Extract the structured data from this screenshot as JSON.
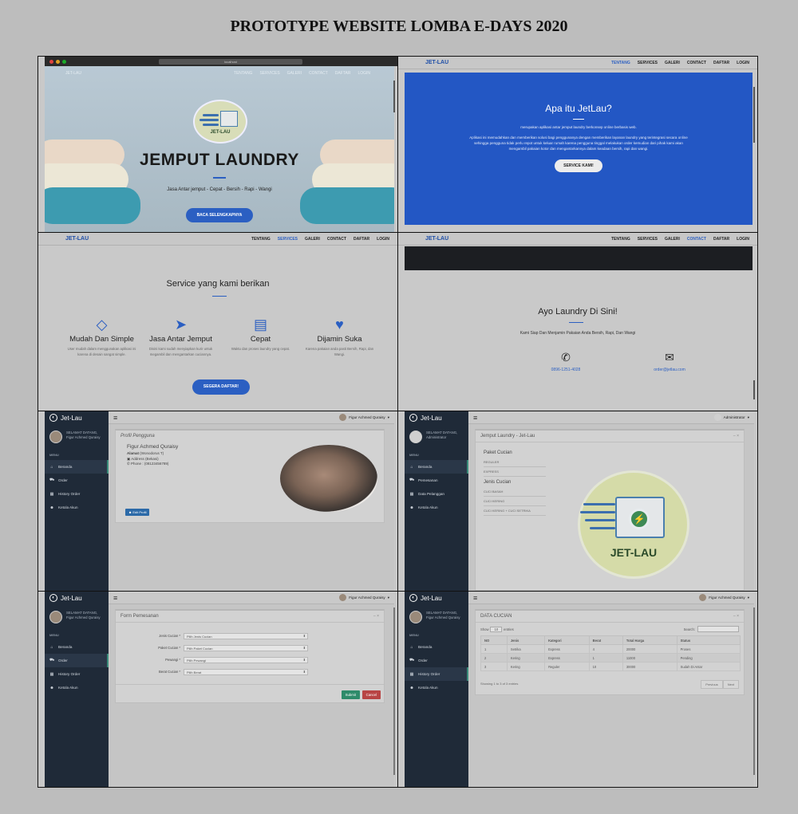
{
  "doc_title": "PROTOTYPE WEBSITE LOMBA E-DAYS 2020",
  "site": {
    "brand": "JET-LAU",
    "nav": [
      "TENTANG",
      "SERVICES",
      "GALERI",
      "CONTACT",
      "DAFTAR",
      "LOGIN"
    ]
  },
  "browser": {
    "address": "localhost"
  },
  "hero": {
    "logo_text": "JET-LAU",
    "title": "JEMPUT LAUNDRY",
    "subtitle": "Jasa Antar jemput - Cepat - Bersih - Rapi - Wangi",
    "button": "BACA SELENGKAPNYA"
  },
  "about": {
    "title": "Apa itu JetLau?",
    "lead": "merupakan aplikasi antar jemput laundry berkonsep online berbasis web.",
    "body": "Aplikasi ini memudahkan dan memberikan solusi bagi penggunanya dengan memberikan layanan laundry yang terintegrasi secara online sehingga pengguna tidak perlu repot untuk keluar rumah karena pengguna tinggal melakukan order kemudian dari pihak kami akan mengambil pakaian kotor dan mengantarkannya dalam keadaan bersih, rapi dan wangi.",
    "button": "SERVICE KAMI!"
  },
  "services": {
    "title": "Service yang kami berikan",
    "items": [
      {
        "icon": "diamond-icon",
        "title": "Mudah Dan Simple",
        "desc": "User mudah dalam menggunakan aplikasi ini karena di desain sangat simple."
      },
      {
        "icon": "paper-plane-icon",
        "title": "Jasa Antar Jemput",
        "desc": "Disini kami sudah menyiapkan kurir untuk megambil dan mengantarkan cuciannya."
      },
      {
        "icon": "newspaper-icon",
        "title": "Cepat",
        "desc": "Waktu dan proses laundry yang cepat."
      },
      {
        "icon": "heart-icon",
        "title": "Dijamin Suka",
        "desc": "Karena pakaian anda pasti Bersih, Rapi, dan Wangi."
      }
    ],
    "button": "SEGERA DAFTAR!"
  },
  "contact": {
    "title": "Ayo Laundry Di Sini!",
    "subtitle": "Kami Siap Dan Menjamin Pakaian Anda Bersih, Rapi, Dan Wangi",
    "phone": "0896-1251-4028",
    "email": "order@jetlau.com"
  },
  "admin": {
    "brand": "Jet-Lau",
    "greeting": "SELAMAT DATANG,",
    "user_name": "Figur Achmed Quraisy",
    "admin_name": "Administrator",
    "menu_header": "MENU",
    "user_menu": [
      "Beranda",
      "Order",
      "History Order",
      "Ketola Akun"
    ],
    "admin_menu": [
      "Beranda",
      "Pemesanan",
      "Data Pelanggan",
      "Ketola Akun"
    ]
  },
  "profile": {
    "title": "Profil Pengguna",
    "name": "Figur Achmed Quraisy",
    "address_label": "Alamat",
    "address": "(Wonodorus T)",
    "city_label": "Address",
    "city": "(Bekasi)",
    "phone_label": "Phone",
    "phone": "(08123456789)",
    "edit_button": "Edit Profil"
  },
  "jemput": {
    "title": "Jemput Laundry - Jet-Lau",
    "paket_title": "Paket Cucian",
    "paket_items": [
      "REGULER",
      "EXPRESS"
    ],
    "jenis_title": "Jenis Cucian",
    "jenis_items": [
      "CUCI BASAH",
      "CUCI KERING",
      "CUCI KERING + CUCI SETRIKA"
    ],
    "logo_text": "JET-LAU"
  },
  "form": {
    "title": "Form Pemesanan",
    "rows": [
      {
        "label": "Jenis Cucian *",
        "value": "Pilih Jenis Cucian"
      },
      {
        "label": "Paket Cucian *",
        "value": "Pilih Paket Cucian"
      },
      {
        "label": "Pewangi *",
        "value": "Pilih Pewangi"
      },
      {
        "label": "Berat Cucian *",
        "value": "Pilih Berat"
      }
    ],
    "submit": "Submit",
    "cancel": "Cancel"
  },
  "table": {
    "title": "DATA CUCIAN",
    "show_label": "Show",
    "show_value": "10",
    "entries_label": "entries",
    "search_label": "Search:",
    "headers": [
      "NO",
      "Jenis",
      "Kategori",
      "Berat",
      "Total Harga",
      "Status"
    ],
    "rows": [
      [
        "1",
        "Setrika",
        "Express",
        "4",
        "20000",
        "Proses"
      ],
      [
        "2",
        "Kering",
        "Express",
        "1",
        "11000",
        "Pending"
      ],
      [
        "3",
        "Kering",
        "Reguler",
        "10",
        "30000",
        "Sudah Di Antar"
      ]
    ],
    "info": "Showing 1 to 3 of 3 entries",
    "prev": "Previous",
    "next": "Next"
  }
}
